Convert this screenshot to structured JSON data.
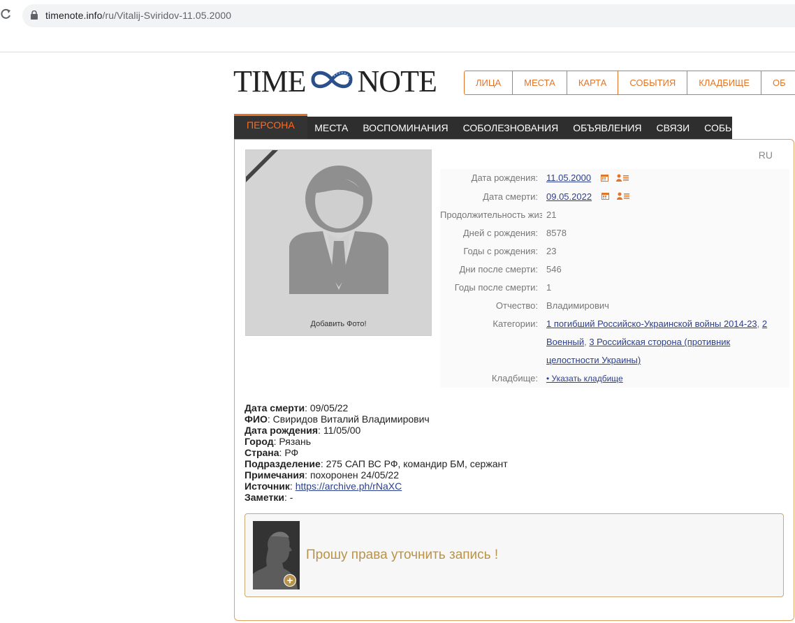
{
  "browser": {
    "url_host": "timenote.info",
    "url_path": "/ru/Vitalij-Sviridov-11.05.2000"
  },
  "logo": {
    "left": "TIME",
    "right": "NOTE"
  },
  "topnav": [
    "ЛИЦА",
    "МЕСТА",
    "КАРТА",
    "СОБЫТИЯ",
    "КЛАДБИЩЕ",
    "ОБ"
  ],
  "tabs": [
    "ПЕРСОНА",
    "МЕСТА",
    "ВОСПОМИНАНИЯ",
    "СОБОЛЕЗНОВАНИЯ",
    "ОБЪЯВЛЕНИЯ",
    "СВЯЗИ",
    "СОБЫТИЯ"
  ],
  "lang": "RU",
  "photo": {
    "caption": "Добавить Фото!"
  },
  "info": {
    "birth_label": "Дата рождения:",
    "birth_value": "11.05.2000",
    "death_label": "Дата смерти:",
    "death_value": "09.05.2022",
    "duration_label": "Продолжительность жизни",
    "duration_value": "21",
    "days_since_birth_label": "Дней с рождения:",
    "days_since_birth_value": "8578",
    "years_since_birth_label": "Годы с рождения:",
    "years_since_birth_value": "23",
    "days_after_death_label": "Дни после смерти:",
    "days_after_death_value": "546",
    "years_after_death_label": "Годы после смерти:",
    "years_after_death_value": "1",
    "patronymic_label": "Отчество:",
    "patronymic_value": "Владимирович",
    "categories_label": "Категории:",
    "category_1": "1 погибший Российско-Украинской войны 2014-23",
    "category_2": "2 Военный",
    "category_3": "3 Российская сторона (противник целостности Украины)",
    "cemetery_label": "Кладбище:",
    "cemetery_value": "• Указать кладбище"
  },
  "details": {
    "death_label": "Дата смерти",
    "death_value": ": 09/05/22",
    "name_label": "ФИО",
    "name_value": ": Свиридов Виталий Владимирович",
    "birth_label": "Дата рождения",
    "birth_value": ": 11/05/00",
    "city_label": "Город",
    "city_value": ": Рязань",
    "country_label": "Страна",
    "country_value": ": РФ",
    "unit_label": "Подразделение",
    "unit_value": ": 275 САП ВС РФ, командир БМ, сержант",
    "notes_label": "Примечания",
    "notes_value": ": похоронен 24/05/22",
    "source_label": "Источник",
    "source_sep": ": ",
    "source_link": "https://archive.ph/rNaXC",
    "memo_label": "Заметки",
    "memo_value": ": -"
  },
  "request": {
    "plus": "+",
    "text": "Прошу права уточнить запись !"
  },
  "colors": {
    "accent": "#e0752a",
    "tabs_bg": "#2e2e2e",
    "link": "#2a3f8f",
    "gold": "#b8934a"
  }
}
